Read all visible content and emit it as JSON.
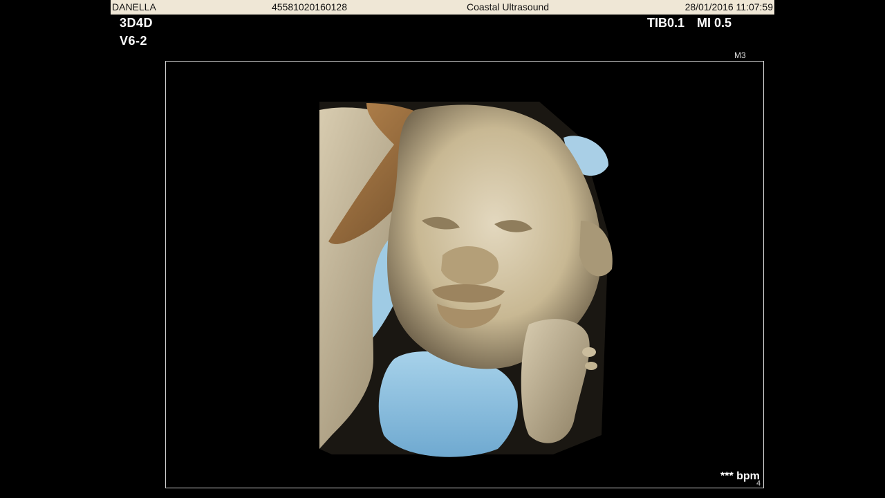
{
  "header": {
    "patient_name": "DANELLA",
    "patient_id": "45581020160128",
    "clinic": "Coastal Ultrasound",
    "datetime": "28/01/2016 11:07:59"
  },
  "mode": {
    "line1": "3D4D",
    "line2": "V6-2"
  },
  "params": {
    "tib": "TIB0.1",
    "mi": "MI 0.5"
  },
  "map": {
    "label": "M3"
  },
  "status": {
    "bpm": "*** bpm",
    "corner": "4"
  },
  "icons": {
    "gray_scale": "grayscale-map-bar"
  },
  "colors": {
    "header_bg": "#efe7d6",
    "tissue": "#cdbf9f",
    "fluid_blue": "#8fc3e0",
    "frame_border": "#cfcfcf"
  }
}
